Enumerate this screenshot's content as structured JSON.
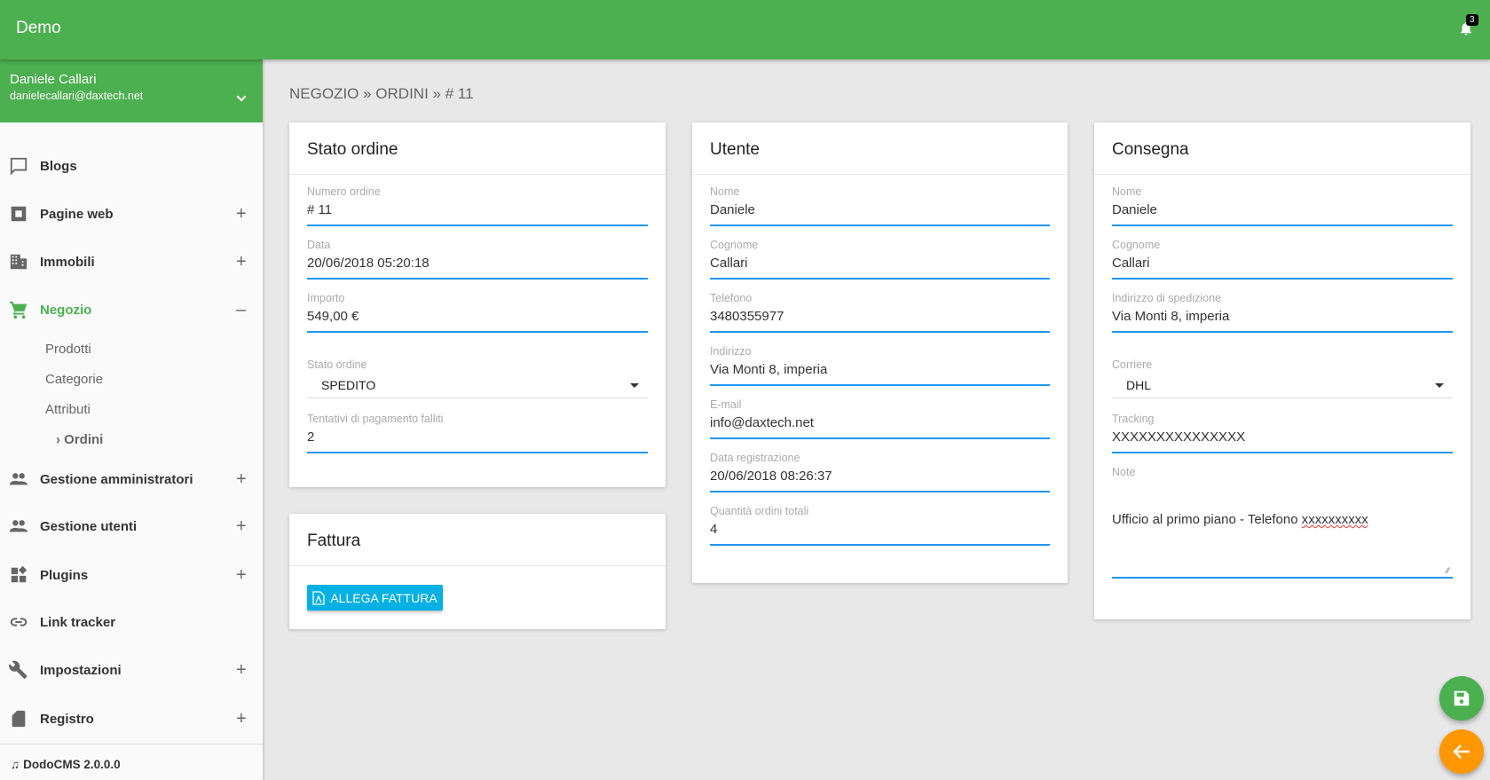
{
  "header": {
    "title": "Demo",
    "notifications": "3"
  },
  "user": {
    "name": "Daniele Callari",
    "email": "danielecallari@daxtech.net"
  },
  "sidebar": {
    "items": [
      {
        "label": "Blogs",
        "icon": "comment-icon"
      },
      {
        "label": "Pagine web",
        "icon": "web-icon",
        "toggle": "+"
      },
      {
        "label": "Immobili",
        "icon": "building-icon",
        "toggle": "+"
      },
      {
        "label": "Negozio",
        "icon": "cart-icon",
        "toggle": "–"
      },
      {
        "label": "Gestione amministratori",
        "icon": "people-icon",
        "toggle": "+"
      },
      {
        "label": "Gestione utenti",
        "icon": "people-icon",
        "toggle": "+"
      },
      {
        "label": "Plugins",
        "icon": "widgets-icon",
        "toggle": "+"
      },
      {
        "label": "Link tracker",
        "icon": "link-icon"
      },
      {
        "label": "Impostazioni",
        "icon": "wrench-icon",
        "toggle": "+"
      },
      {
        "label": "Registro",
        "icon": "sd-card-icon",
        "toggle": "+"
      }
    ],
    "sub_items": [
      "Prodotti",
      "Categorie",
      "Attributi",
      "Ordini"
    ],
    "footer": "DodoCMS 2.0.0.0"
  },
  "breadcrumb": "NEGOZIO » ORDINI » # 11",
  "stato": {
    "title": "Stato ordine",
    "fields": [
      {
        "label": "Numero ordine",
        "value": "# 11"
      },
      {
        "label": "Data",
        "value": "20/06/2018 05:20:18"
      },
      {
        "label": "Importo",
        "value": "549,00 €"
      },
      {
        "label": "Stato ordine",
        "value": "SPEDITO"
      },
      {
        "label": "Tentativi di pagamento falliti",
        "value": "2"
      }
    ]
  },
  "fattura": {
    "title": "Fattura",
    "button": "ALLEGA FATTURA"
  },
  "utente": {
    "title": "Utente",
    "fields": [
      {
        "label": "Nome",
        "value": "Daniele"
      },
      {
        "label": "Cognome",
        "value": "Callari"
      },
      {
        "label": "Telefono",
        "value": "3480355977"
      },
      {
        "label": "Indirizzo",
        "value": "Via Monti 8, imperia"
      },
      {
        "label": "E-mail",
        "value": "info@daxtech.net"
      },
      {
        "label": "Data registrazione",
        "value": "20/06/2018 08:26:37"
      },
      {
        "label": "Quantità ordini totali",
        "value": "4"
      }
    ]
  },
  "consegna": {
    "title": "Consegna",
    "fields": [
      {
        "label": "Nome",
        "value": "Daniele"
      },
      {
        "label": "Cognome",
        "value": "Callari"
      },
      {
        "label": "Indirizzo di spedizione",
        "value": "Via Monti 8, imperia"
      },
      {
        "label": "Corriere",
        "value": "DHL"
      },
      {
        "label": "Tracking",
        "value": "XXXXXXXXXXXXXXX"
      },
      {
        "label": "Note",
        "value_a": "Ufficio al primo piano - Telefono ",
        "value_b": "xxxxxxxxxx"
      }
    ]
  },
  "colors": {
    "primary": "#4caf50",
    "accent": "#2196f3",
    "button": "#03b0e3",
    "back": "#ff9800"
  }
}
